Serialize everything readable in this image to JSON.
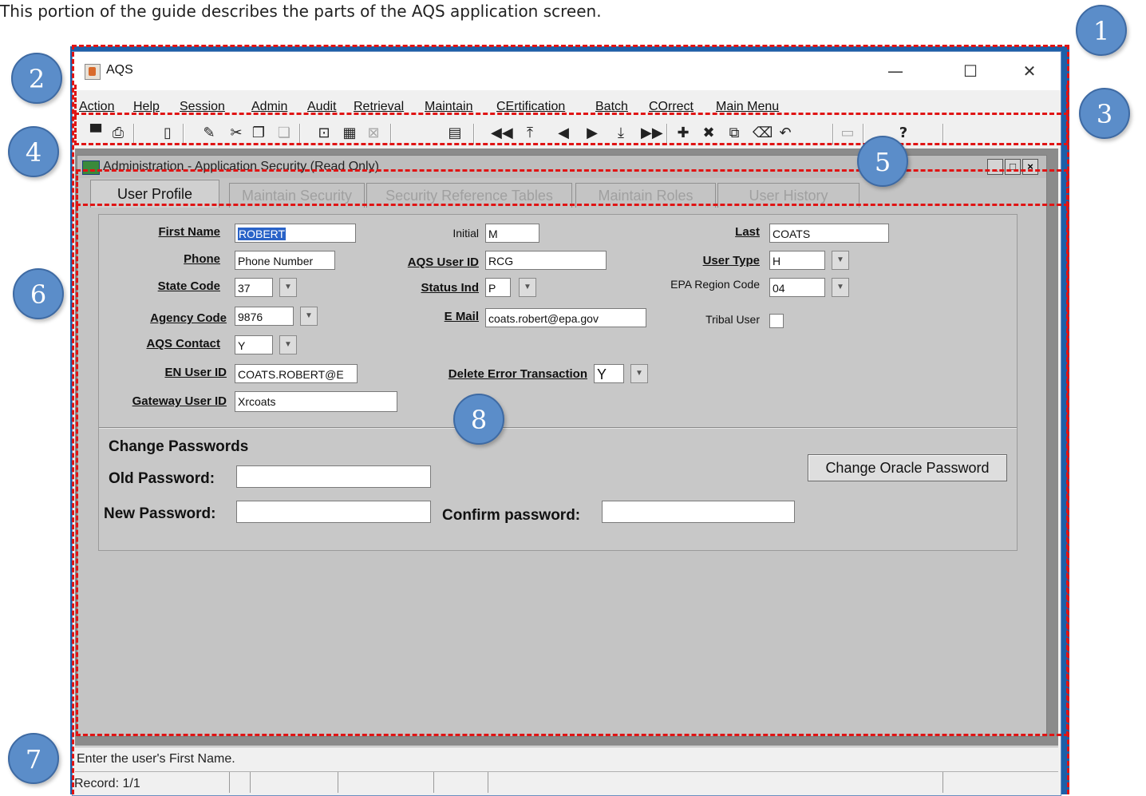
{
  "intro_text": "This portion of the guide describes the parts of the AQS application screen.",
  "window": {
    "title": "AQS",
    "controls": [
      "—",
      "☐",
      "✕"
    ]
  },
  "menu": [
    "Action",
    "Help",
    "Session",
    "Admin",
    "Audit",
    "Retrieval",
    "Maintain",
    "CErtification",
    "Batch",
    "COrrect",
    "Main Menu"
  ],
  "toolbar_icons": [
    "save-icon",
    "print-icon",
    "exit-icon",
    "edit-icon",
    "cut-icon",
    "copy-icon",
    "paste-icon",
    "query-icon",
    "execute-query-icon",
    "cancel-query-icon",
    "calculator-icon",
    "first-record-icon",
    "top-record-icon",
    "previous-record-icon",
    "next-record-icon",
    "down-record-icon",
    "last-record-icon",
    "insert-record-icon",
    "delete-record-icon",
    "duplicate-record-icon",
    "clear-record-icon",
    "undo-icon",
    "list-icon",
    "help-icon"
  ],
  "inner_window": {
    "title": "Administration - Application Security (Read Only)"
  },
  "tabs": [
    "User Profile",
    "Maintain Security",
    "Security Reference Tables",
    "Maintain Roles",
    "User History"
  ],
  "form": {
    "first_name": {
      "label": "First Name",
      "value": "ROBERT"
    },
    "initial": {
      "label": "Initial",
      "value": "M"
    },
    "last": {
      "label": "Last",
      "value": "COATS"
    },
    "phone": {
      "label": "Phone",
      "value": "Phone Number"
    },
    "aqs_user_id": {
      "label": "AQS User ID",
      "value": "RCG"
    },
    "user_type": {
      "label": "User Type",
      "value": "H"
    },
    "state_code": {
      "label": "State Code",
      "value": "37"
    },
    "status_ind": {
      "label": "Status Ind",
      "value": "P"
    },
    "epa_region_code": {
      "label": "EPA Region Code",
      "value": "04"
    },
    "agency_code": {
      "label": "Agency Code",
      "value": "9876"
    },
    "email": {
      "label": "E Mail",
      "value": "coats.robert@epa.gov"
    },
    "tribal_user": {
      "label": "Tribal User",
      "checked": false
    },
    "aqs_contact": {
      "label": "AQS Contact",
      "value": "Y"
    },
    "en_user_id": {
      "label": "EN  User ID",
      "value": "COATS.ROBERT@E"
    },
    "delete_error_transaction": {
      "label": "Delete Error Transaction",
      "value": "Y"
    },
    "gateway_user_id": {
      "label": "Gateway  User ID",
      "value": "Xrcoats"
    }
  },
  "passwords": {
    "heading": "Change Passwords",
    "old_label": "Old Password:",
    "new_label": "New Password:",
    "confirm_label": "Confirm password:",
    "change_oracle_button": "Change Oracle Password"
  },
  "status": {
    "message": "Enter the user's First Name.",
    "record": "Record: 1/1"
  },
  "callouts": [
    "1",
    "2",
    "3",
    "4",
    "5",
    "6",
    "7",
    "8"
  ],
  "annotation_color": "#e01414",
  "callout_color": "#5b8dc9"
}
